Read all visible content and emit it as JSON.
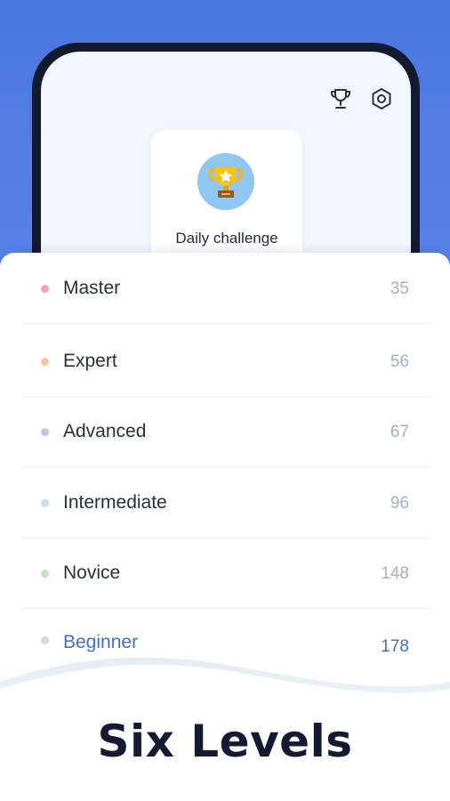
{
  "header": {
    "trophy_icon": "trophy-icon",
    "settings_icon": "settings-gear-icon"
  },
  "daily_challenge": {
    "label": "Daily challenge",
    "icon": "gold-trophy-icon"
  },
  "levels": [
    {
      "name": "Master",
      "count": "35",
      "color": "#f4a6a6"
    },
    {
      "name": "Expert",
      "count": "56",
      "color": "#f7c4a0"
    },
    {
      "name": "Advanced",
      "count": "67",
      "color": "#cdbdf0"
    },
    {
      "name": "Intermediate",
      "count": "96",
      "color": "#bfe0fb"
    },
    {
      "name": "Novice",
      "count": "148",
      "color": "#bfe8b8"
    },
    {
      "name": "Beginner",
      "count": "178",
      "color": "#d4d6dc"
    }
  ],
  "headline": "Six Levels",
  "colors": {
    "background": "#4a76e0",
    "accent": "#3b6fd4",
    "headline": "#141a33"
  }
}
